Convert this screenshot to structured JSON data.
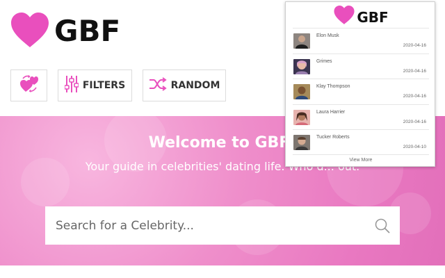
{
  "app": {
    "logo_text": "GBF",
    "brand_color": "#e94fbd"
  },
  "buttons": {
    "match_icon": "hearts-swap-icon",
    "filters_label": "FILTERS",
    "filters_icon": "sliders-icon",
    "random_label": "RANDOM",
    "random_icon": "shuffle-icon"
  },
  "hero": {
    "title": "Welcome to GBF!",
    "subtitle": "Your guide in celebrities' dating life. Who d... out."
  },
  "search": {
    "placeholder": "Search for a Celebrity...",
    "icon": "search-icon"
  },
  "popup": {
    "logo_text": "GBF",
    "items": [
      {
        "name": "Elon Musk",
        "date": "2020-04-16",
        "avatar_color": "#5a4a40"
      },
      {
        "name": "Grimes",
        "date": "2020-04-16",
        "avatar_color": "#c9a0b8"
      },
      {
        "name": "Klay Thompson",
        "date": "2020-04-16",
        "avatar_color": "#6b5a3a"
      },
      {
        "name": "Laura Harrier",
        "date": "2020-04-16",
        "avatar_color": "#d38e86"
      },
      {
        "name": "Tucker Roberts",
        "date": "2020-04-10",
        "avatar_color": "#6d6660"
      }
    ],
    "view_more": "View More"
  }
}
